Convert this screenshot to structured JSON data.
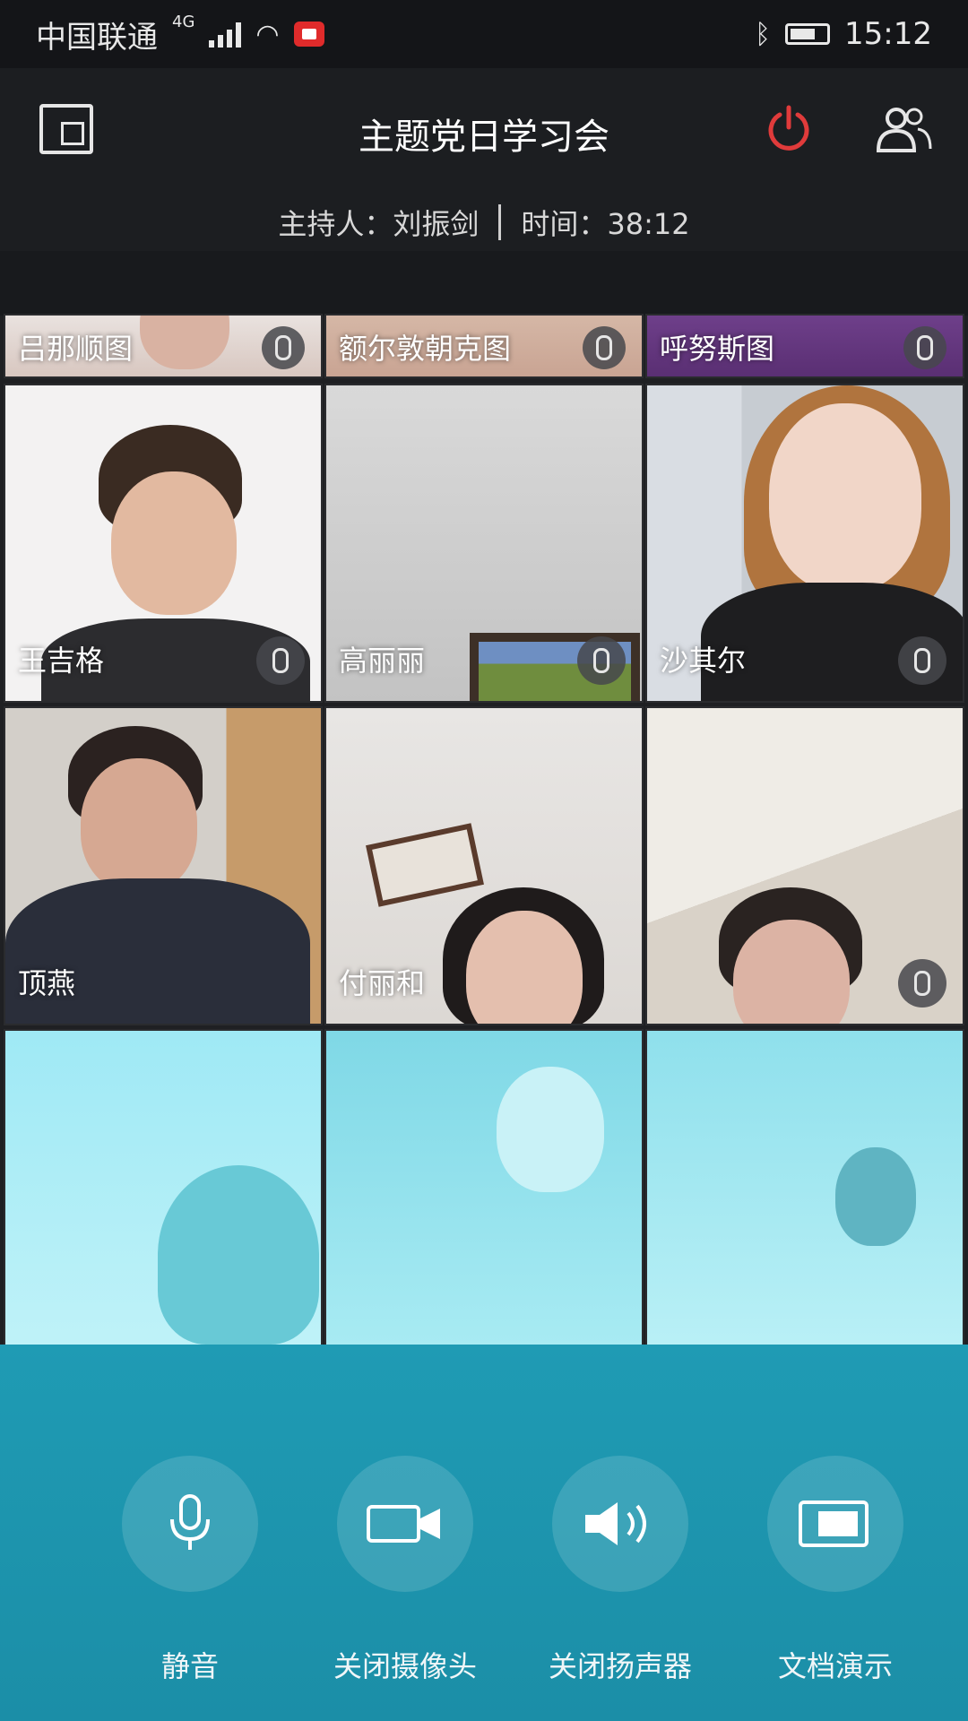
{
  "status_bar": {
    "carrier": "中国联通",
    "network": "4G",
    "time": "15:12"
  },
  "header": {
    "title": "主题党日学习会",
    "host_label": "主持人：",
    "host_name": "刘振剑",
    "time_label": "时间：",
    "elapsed": "38:12"
  },
  "participants": [
    {
      "name": "吕那顺图",
      "muted": true
    },
    {
      "name": "额尔敦朝克图",
      "muted": true
    },
    {
      "name": "呼努斯图",
      "muted": true
    },
    {
      "name": "王吉格",
      "muted": true
    },
    {
      "name": "高丽丽",
      "muted": true
    },
    {
      "name": "沙其尔",
      "muted": true
    },
    {
      "name": "顶燕",
      "muted": false
    },
    {
      "name": "付丽和",
      "muted": false
    },
    {
      "name": "",
      "muted": true
    },
    {
      "name": "",
      "muted": false
    },
    {
      "name": "",
      "muted": false
    },
    {
      "name": "",
      "muted": false
    }
  ],
  "controls": {
    "mute_label": "静音",
    "camera_label": "关闭摄像头",
    "speaker_label": "关闭扬声器",
    "document_label": "文档演示"
  },
  "colors": {
    "accent_red": "#e03b3b",
    "panel_teal": "#1f9bb4",
    "background_dark": "#1c1e21"
  }
}
